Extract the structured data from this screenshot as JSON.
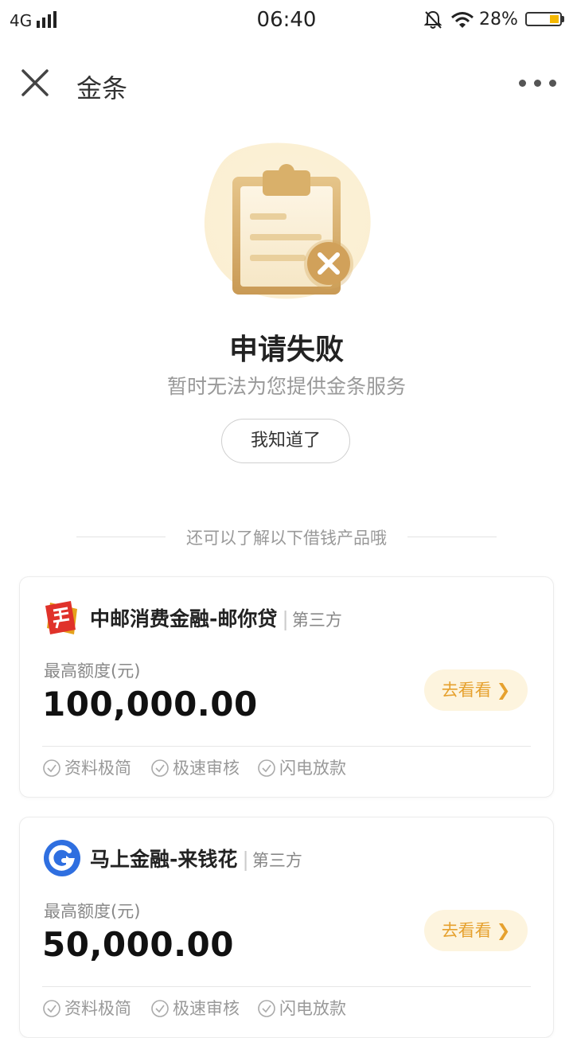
{
  "status_bar": {
    "network": "4G",
    "time": "06:40",
    "battery": "28%",
    "battery_level": 0.28,
    "accent": "#f5b800"
  },
  "nav": {
    "close_icon": "close-icon",
    "title": "金条",
    "more_icon": "more-icon"
  },
  "result": {
    "icon": "clipboard-fail-icon",
    "title": "申请失败",
    "subtitle": "暂时无法为您提供金条服务",
    "button": "我知道了"
  },
  "divider_text": "还可以了解以下借钱产品哦",
  "products": [
    {
      "logo": "china-post-logo",
      "name": "中邮消费金融-邮你贷",
      "separator": "|",
      "tag": "第三方",
      "amount_label": "最高额度(元)",
      "amount": "100,000.00",
      "button": "去看看",
      "features": [
        "资料极简",
        "极速审核",
        "闪电放款"
      ]
    },
    {
      "logo": "mashang-logo",
      "name": "马上金融-来钱花",
      "separator": "|",
      "tag": "第三方",
      "amount_label": "最高额度(元)",
      "amount": "50,000.00",
      "button": "去看看",
      "features": [
        "资料极简",
        "极速审核",
        "闪电放款"
      ]
    }
  ],
  "colors": {
    "button_bg": "#fdf4de",
    "button_text": "#e6a12e"
  }
}
